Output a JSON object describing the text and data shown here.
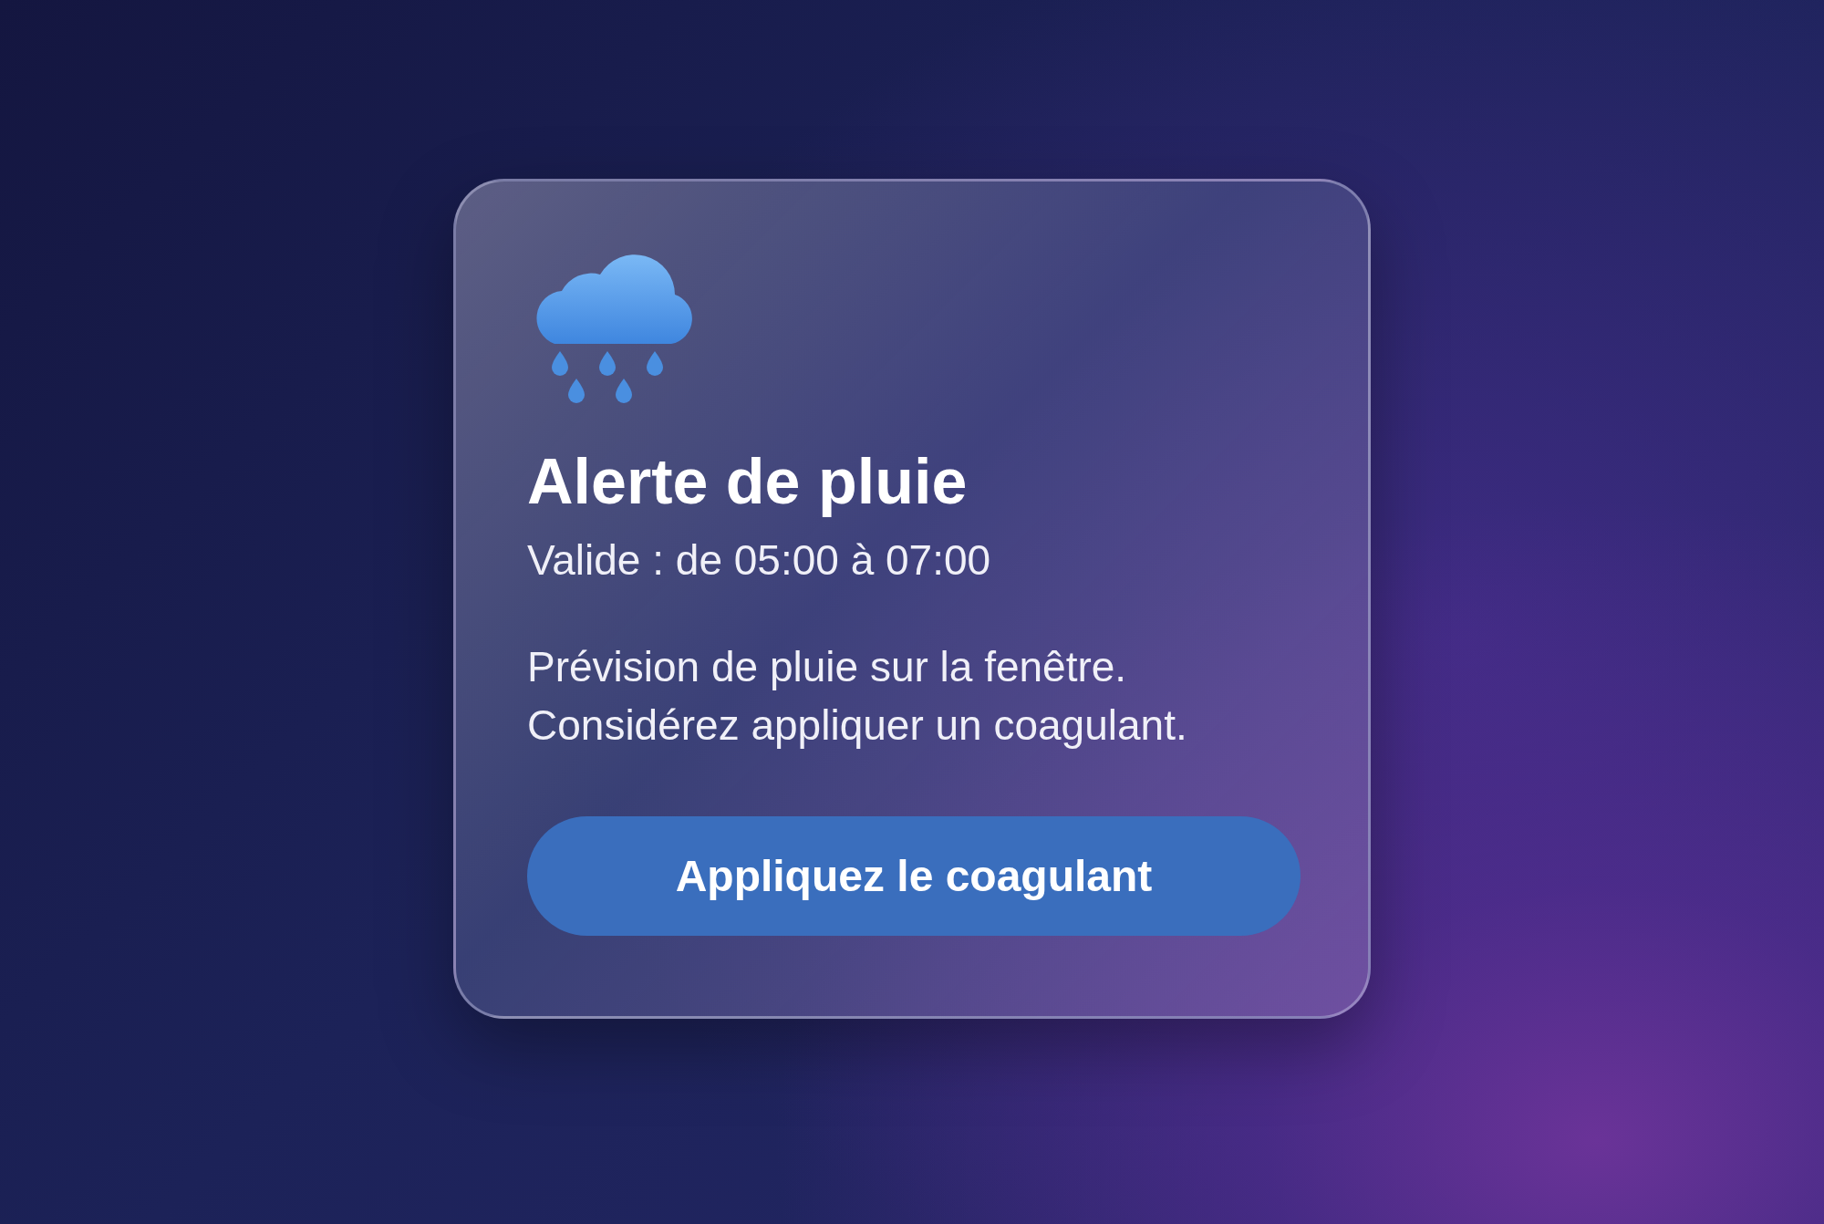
{
  "alert": {
    "title": "Alerte de pluie",
    "validity": "Valide : de 05:00 à 07:00",
    "message": "Prévision de pluie sur la fenêtre. Considérez appliquer un coagulant.",
    "button": "Appliquez le coagulant"
  }
}
